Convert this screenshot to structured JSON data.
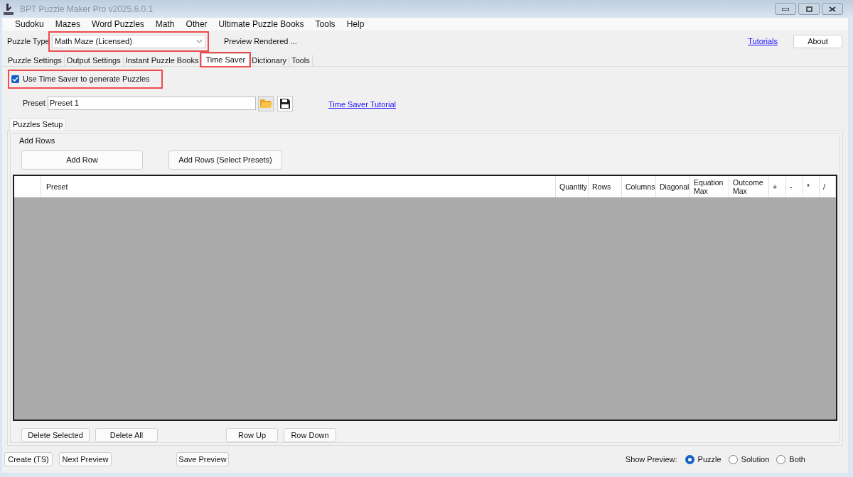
{
  "window": {
    "title": "BPT Puzzle Maker Pro v2025.6.0.1"
  },
  "menu": [
    "Sudoku",
    "Mazes",
    "Word Puzzles",
    "Math",
    "Other",
    "Ultimate Puzzle Books",
    "Tools",
    "Help"
  ],
  "puzzle_type": {
    "label": "Puzzle Type",
    "value": "Math Maze (Licensed)",
    "highlighted": true
  },
  "preview_status": "Preview Rendered ...",
  "tutorials_link": "Tutorials",
  "about_button": "About",
  "tabs": [
    {
      "label": "Puzzle Settings",
      "selected": false,
      "highlighted": false
    },
    {
      "label": "Output Settings",
      "selected": false,
      "highlighted": false
    },
    {
      "label": "Instant Puzzle Books",
      "selected": false,
      "highlighted": false
    },
    {
      "label": "Time Saver",
      "selected": true,
      "highlighted": true
    },
    {
      "label": "Dictionary",
      "selected": false,
      "highlighted": false
    },
    {
      "label": "Tools",
      "selected": false,
      "highlighted": false
    }
  ],
  "use_time_saver": {
    "label": "Use Time Saver to generate Puzzles",
    "checked": true,
    "highlighted": true
  },
  "preset": {
    "label": "Preset",
    "value": "Preset 1"
  },
  "time_saver_tutorial_link": "Time Saver Tutorial",
  "inner_tabs": [
    {
      "label": "Puzzles Setup",
      "selected": true
    }
  ],
  "add_rows_group": {
    "title": "Add Rows",
    "buttons": [
      "Add Row",
      "Add Rows (Select Presets)"
    ]
  },
  "table": {
    "columns": [
      "Preset",
      "Quantity",
      "Rows",
      "Columns",
      "Diagonal",
      "Equation Max",
      "Outcome Max",
      "+",
      "-",
      "*",
      "/"
    ]
  },
  "row_buttons": [
    "Delete Selected",
    "Delete All",
    "Row Up",
    "Row Down"
  ],
  "bottom_buttons": [
    "Create (TS)",
    "Next Preview",
    "Save Preview"
  ],
  "show_preview": {
    "label": "Show Preview:",
    "options": [
      {
        "label": "Puzzle",
        "selected": true
      },
      {
        "label": "Solution",
        "selected": false
      },
      {
        "label": "Both",
        "selected": false
      }
    ]
  }
}
